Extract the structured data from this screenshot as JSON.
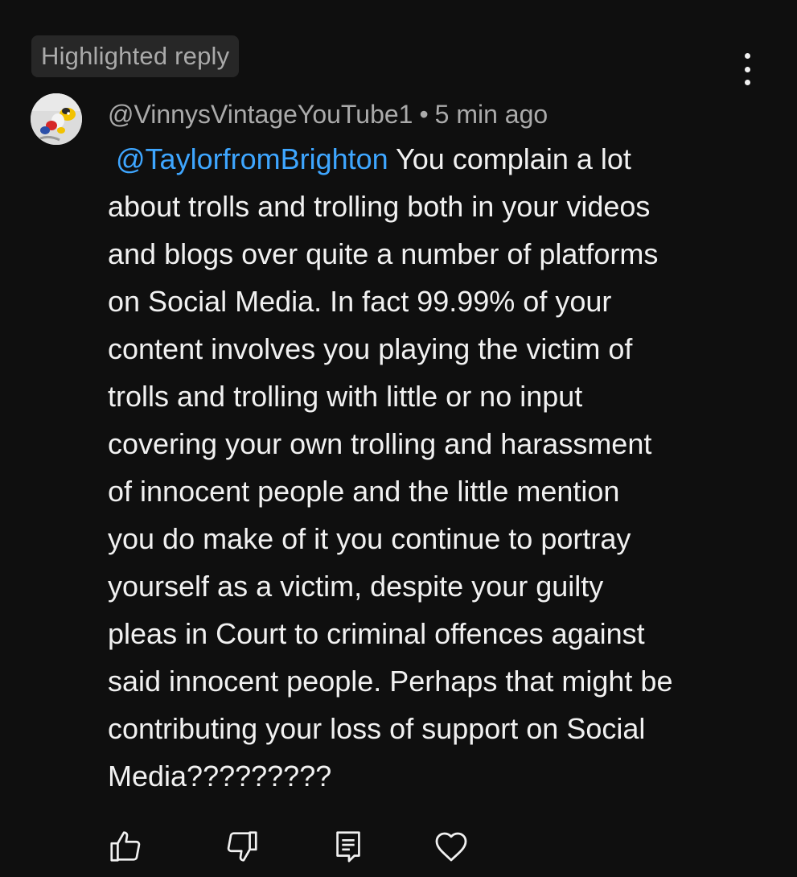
{
  "badge": {
    "label": "Highlighted reply"
  },
  "comment": {
    "author": "@VinnysVintageYouTube1",
    "separator": "•",
    "time": "5 min ago",
    "mention": "@TaylorfromBrighton",
    "text": " You complain a lot\nabout trolls and trolling both in your videos\nand blogs over quite a number of platforms\non Social Media. In fact 99.99% of your\ncontent involves you playing the victim of\ntrolls and trolling with little or no input\ncovering your own trolling and harassment\nof innocent people and the little mention\nyou do make of it you continue to portray\nyourself as a victim, despite your guilty\npleas in Court to criminal offences against\nsaid innocent people. Perhaps that might be\ncontributing your loss of support on Social\nMedia?????????"
  },
  "actions": [
    {
      "name": "like",
      "icon": "thumbs-up-icon"
    },
    {
      "name": "dislike",
      "icon": "thumbs-down-icon"
    },
    {
      "name": "reply",
      "icon": "reply-comment-icon"
    },
    {
      "name": "heart",
      "icon": "heart-icon"
    }
  ],
  "colors": {
    "background": "#0f0f0f",
    "text": "#f1f1f1",
    "secondary_text": "#aaaaaa",
    "mention": "#3ea6ff",
    "badge_background": "#272727"
  }
}
